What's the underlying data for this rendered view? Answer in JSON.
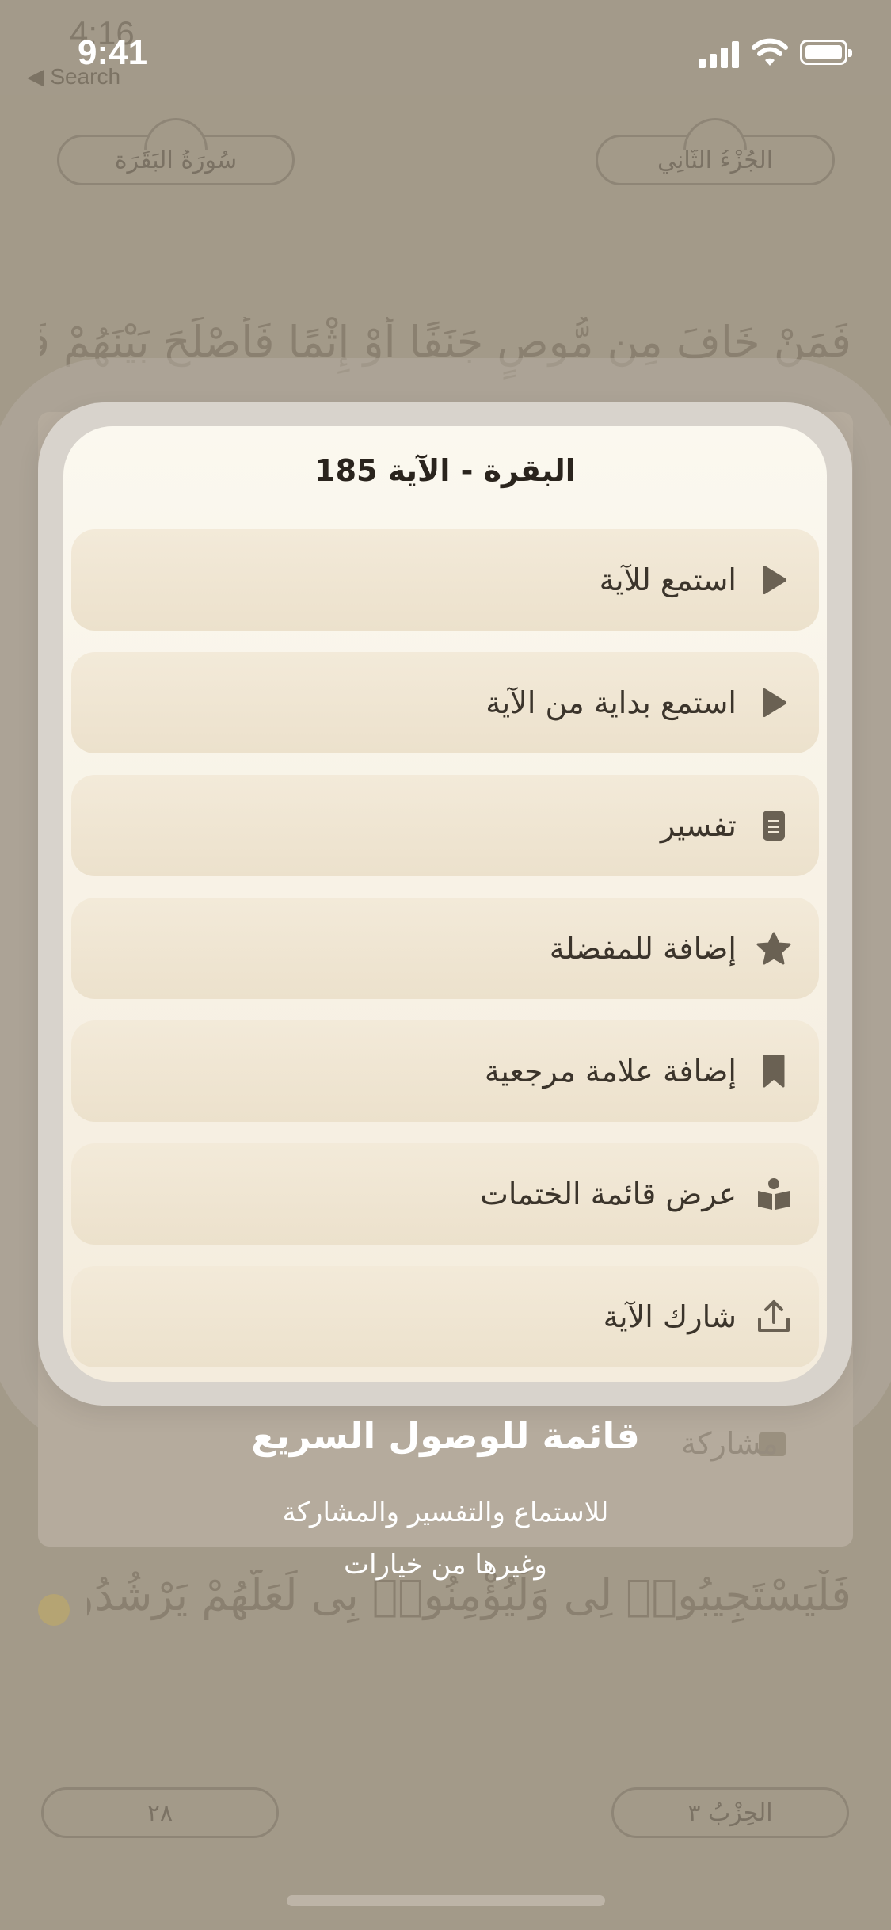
{
  "status_bar": {
    "time": "9:41",
    "ghost_time": "4:16",
    "back_label": "◀ Search"
  },
  "background": {
    "surah_name": "سُورَةُ البَقَرَة",
    "juz_name": "الجُزْءُ الثَّانِي",
    "quran_line_top": "فَمَنْ خَافَ مِن مُّوصٍ جَنَفًا أَوْ إِثْمًا فَأَصْلَحَ بَيْنَهُمْ فَلَآ إِثْمَ",
    "quran_line_bottom": "فَلْيَسْتَجِيبُوا۟ لِى وَلْيُؤْمِنُوا۟ بِى لَعَلَّهُمْ يَرْشُدُونَ",
    "page_number": "٢٨",
    "hizb_label": "الحِزْبُ ٣",
    "under_item_label": "مشاركة"
  },
  "menu": {
    "title": "البقرة - الآية 185",
    "items": [
      {
        "label": "استمع للآية",
        "icon": "play-icon"
      },
      {
        "label": "استمع بداية من الآية",
        "icon": "play-icon"
      },
      {
        "label": "تفسير",
        "icon": "document-icon"
      },
      {
        "label": "إضافة للمفضلة",
        "icon": "star-icon"
      },
      {
        "label": "إضافة علامة مرجعية",
        "icon": "bookmark-icon"
      },
      {
        "label": "عرض قائمة الختمات",
        "icon": "reading-icon"
      },
      {
        "label": "شارك الآية",
        "icon": "share-icon"
      }
    ]
  },
  "tooltip": {
    "title": "قائمة للوصول السريع",
    "line1": "للاستماع والتفسير والمشاركة",
    "line2": "وغيرها من خيارات"
  },
  "colors": {
    "icon": "#6a6153",
    "text": "#3b342b",
    "overlay": "#a39a8a"
  }
}
